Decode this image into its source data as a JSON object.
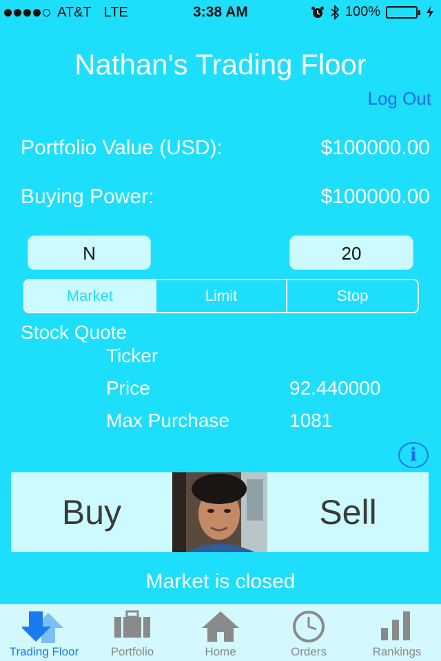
{
  "status_bar": {
    "carrier": "AT&T",
    "network": "LTE",
    "time": "3:38 AM",
    "battery": "100%",
    "icons": [
      "alarm-icon",
      "bluetooth-icon",
      "battery-icon",
      "charging-icon"
    ]
  },
  "header": {
    "title": "Nathan's Trading Floor",
    "logout_label": "Log Out"
  },
  "account": {
    "portfolio_label": "Portfolio Value (USD):",
    "portfolio_value": "$100000.00",
    "buying_power_label": "Buying Power:",
    "buying_power_value": "$100000.00"
  },
  "order_form": {
    "ticker_value": "N",
    "quantity_value": "20",
    "order_types": [
      "Market",
      "Limit",
      "Stop"
    ],
    "selected_order_type": "Market"
  },
  "quote": {
    "heading": "Stock Quote",
    "ticker_label": "Ticker",
    "ticker_value": "",
    "price_label": "Price",
    "price_value": "92.440000",
    "max_purchase_label": "Max Purchase",
    "max_purchase_value": "1081"
  },
  "actions": {
    "buy_label": "Buy",
    "sell_label": "Sell"
  },
  "market_status": "Market is closed",
  "tab_bar": {
    "tabs": [
      {
        "label": "Trading Floor",
        "icon": "up-down-arrows-icon"
      },
      {
        "label": "Portfolio",
        "icon": "briefcase-icon"
      },
      {
        "label": "Home",
        "icon": "house-icon"
      },
      {
        "label": "Orders",
        "icon": "clock-icon"
      },
      {
        "label": "Rankings",
        "icon": "bar-chart-icon"
      }
    ],
    "active": "Trading Floor"
  },
  "colors": {
    "background": "#1ddffb",
    "panel": "#ccfaff",
    "accent_blue": "#1a6ef0",
    "tab_inactive": "#8a8a8a"
  }
}
